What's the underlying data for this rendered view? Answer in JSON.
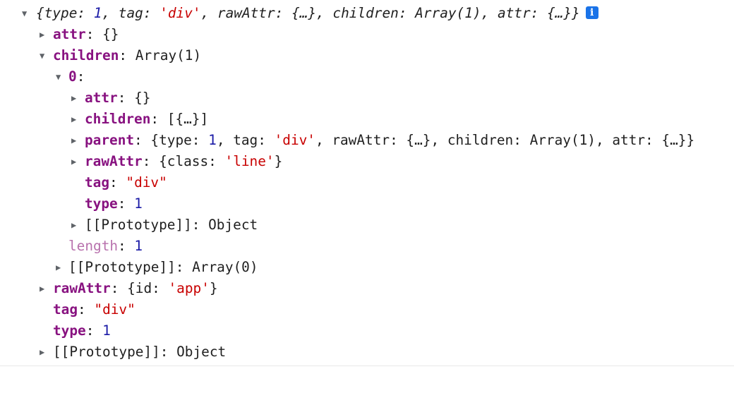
{
  "root": {
    "summary": {
      "open": "{",
      "k_type": "type",
      "v_type": "1",
      "k_tag": "tag",
      "v_tag": "'div'",
      "k_rawAttr": "rawAttr",
      "v_rawAttr": "{…}",
      "k_children": "children",
      "v_children": "Array(1)",
      "k_attr": "attr",
      "v_attr": "{…}",
      "close": "}",
      "info_icon": "i"
    },
    "attr": {
      "key": "attr",
      "value": "{}"
    },
    "children": {
      "key": "children",
      "value": "Array(1)",
      "item0": {
        "key": "0",
        "attr": {
          "key": "attr",
          "value": "{}"
        },
        "children": {
          "key": "children",
          "value": "[{…}]"
        },
        "parent": {
          "key": "parent",
          "open": "{",
          "k_type": "type",
          "v_type": "1",
          "k_tag": "tag",
          "v_tag": "'div'",
          "k_rawAttr": "rawAttr",
          "v_rawAttr": "{…}",
          "k_children": "children",
          "v_children": "Array(1)",
          "k_attr": "attr",
          "v_attr": "{…}",
          "close": "}"
        },
        "rawAttr": {
          "key": "rawAttr",
          "open": "{",
          "k_class": "class",
          "v_class": "'line'",
          "close": "}"
        },
        "tag": {
          "key": "tag",
          "value": "\"div\""
        },
        "type": {
          "key": "type",
          "value": "1"
        },
        "prototype": {
          "key": "[[Prototype]]",
          "value": "Object"
        }
      },
      "length": {
        "key": "length",
        "value": "1"
      },
      "prototype": {
        "key": "[[Prototype]]",
        "value": "Array(0)"
      }
    },
    "rawAttr": {
      "key": "rawAttr",
      "open": "{",
      "k_id": "id",
      "v_id": "'app'",
      "close": "}"
    },
    "tag": {
      "key": "tag",
      "value": "\"div\""
    },
    "type": {
      "key": "type",
      "value": "1"
    },
    "prototype": {
      "key": "[[Prototype]]",
      "value": "Object"
    }
  },
  "icons": {
    "expanded": "▼",
    "collapsed": "▶"
  }
}
